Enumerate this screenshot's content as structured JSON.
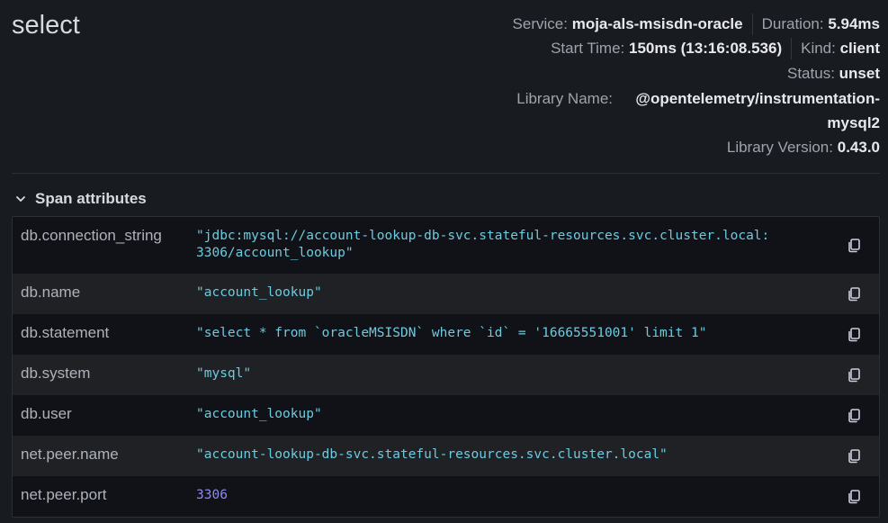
{
  "span": {
    "name": "select",
    "service_label": "Service:",
    "service": "moja-als-msisdn-oracle",
    "duration_label": "Duration:",
    "duration": "5.94ms",
    "start_time_label": "Start Time:",
    "start_time": "150ms (13:16:08.536)",
    "kind_label": "Kind:",
    "kind": "client",
    "status_label": "Status:",
    "status": "unset",
    "library_name_label": "Library Name:",
    "library_name": "@opentelemetry/instrumentation-mysql2",
    "library_version_label": "Library Version:",
    "library_version": "0.43.0"
  },
  "attributes_section": {
    "title": "Span attributes",
    "rows": [
      {
        "key": "db.connection_string",
        "value": "\"jdbc:mysql://account-lookup-db-svc.stateful-resources.svc.cluster.local:3306/account_lookup\""
      },
      {
        "key": "db.name",
        "value": "\"account_lookup\""
      },
      {
        "key": "db.statement",
        "value": "\"select * from `oracleMSISDN` where `id` = '16665551001' limit 1\""
      },
      {
        "key": "db.system",
        "value": "\"mysql\""
      },
      {
        "key": "db.user",
        "value": "\"account_lookup\""
      },
      {
        "key": "net.peer.name",
        "value": "\"account-lookup-db-svc.stateful-resources.svc.cluster.local\""
      },
      {
        "key": "net.peer.port",
        "value": "3306"
      }
    ]
  },
  "icons": {
    "copy": "copy-icon",
    "chevron": "chevron-down-icon"
  }
}
